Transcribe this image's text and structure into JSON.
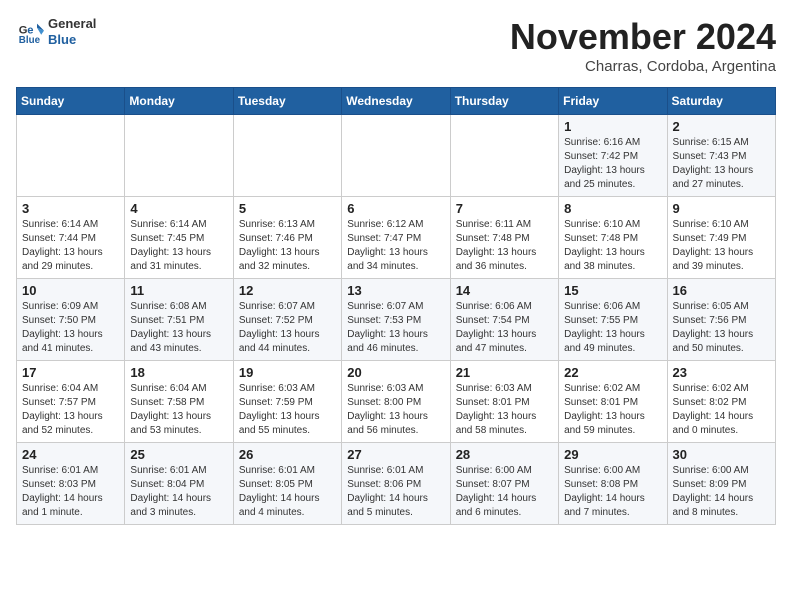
{
  "header": {
    "logo_line1": "General",
    "logo_line2": "Blue",
    "month_title": "November 2024",
    "subtitle": "Charras, Cordoba, Argentina"
  },
  "weekdays": [
    "Sunday",
    "Monday",
    "Tuesday",
    "Wednesday",
    "Thursday",
    "Friday",
    "Saturday"
  ],
  "weeks": [
    [
      {
        "day": "",
        "info": ""
      },
      {
        "day": "",
        "info": ""
      },
      {
        "day": "",
        "info": ""
      },
      {
        "day": "",
        "info": ""
      },
      {
        "day": "",
        "info": ""
      },
      {
        "day": "1",
        "info": "Sunrise: 6:16 AM\nSunset: 7:42 PM\nDaylight: 13 hours\nand 25 minutes."
      },
      {
        "day": "2",
        "info": "Sunrise: 6:15 AM\nSunset: 7:43 PM\nDaylight: 13 hours\nand 27 minutes."
      }
    ],
    [
      {
        "day": "3",
        "info": "Sunrise: 6:14 AM\nSunset: 7:44 PM\nDaylight: 13 hours\nand 29 minutes."
      },
      {
        "day": "4",
        "info": "Sunrise: 6:14 AM\nSunset: 7:45 PM\nDaylight: 13 hours\nand 31 minutes."
      },
      {
        "day": "5",
        "info": "Sunrise: 6:13 AM\nSunset: 7:46 PM\nDaylight: 13 hours\nand 32 minutes."
      },
      {
        "day": "6",
        "info": "Sunrise: 6:12 AM\nSunset: 7:47 PM\nDaylight: 13 hours\nand 34 minutes."
      },
      {
        "day": "7",
        "info": "Sunrise: 6:11 AM\nSunset: 7:48 PM\nDaylight: 13 hours\nand 36 minutes."
      },
      {
        "day": "8",
        "info": "Sunrise: 6:10 AM\nSunset: 7:48 PM\nDaylight: 13 hours\nand 38 minutes."
      },
      {
        "day": "9",
        "info": "Sunrise: 6:10 AM\nSunset: 7:49 PM\nDaylight: 13 hours\nand 39 minutes."
      }
    ],
    [
      {
        "day": "10",
        "info": "Sunrise: 6:09 AM\nSunset: 7:50 PM\nDaylight: 13 hours\nand 41 minutes."
      },
      {
        "day": "11",
        "info": "Sunrise: 6:08 AM\nSunset: 7:51 PM\nDaylight: 13 hours\nand 43 minutes."
      },
      {
        "day": "12",
        "info": "Sunrise: 6:07 AM\nSunset: 7:52 PM\nDaylight: 13 hours\nand 44 minutes."
      },
      {
        "day": "13",
        "info": "Sunrise: 6:07 AM\nSunset: 7:53 PM\nDaylight: 13 hours\nand 46 minutes."
      },
      {
        "day": "14",
        "info": "Sunrise: 6:06 AM\nSunset: 7:54 PM\nDaylight: 13 hours\nand 47 minutes."
      },
      {
        "day": "15",
        "info": "Sunrise: 6:06 AM\nSunset: 7:55 PM\nDaylight: 13 hours\nand 49 minutes."
      },
      {
        "day": "16",
        "info": "Sunrise: 6:05 AM\nSunset: 7:56 PM\nDaylight: 13 hours\nand 50 minutes."
      }
    ],
    [
      {
        "day": "17",
        "info": "Sunrise: 6:04 AM\nSunset: 7:57 PM\nDaylight: 13 hours\nand 52 minutes."
      },
      {
        "day": "18",
        "info": "Sunrise: 6:04 AM\nSunset: 7:58 PM\nDaylight: 13 hours\nand 53 minutes."
      },
      {
        "day": "19",
        "info": "Sunrise: 6:03 AM\nSunset: 7:59 PM\nDaylight: 13 hours\nand 55 minutes."
      },
      {
        "day": "20",
        "info": "Sunrise: 6:03 AM\nSunset: 8:00 PM\nDaylight: 13 hours\nand 56 minutes."
      },
      {
        "day": "21",
        "info": "Sunrise: 6:03 AM\nSunset: 8:01 PM\nDaylight: 13 hours\nand 58 minutes."
      },
      {
        "day": "22",
        "info": "Sunrise: 6:02 AM\nSunset: 8:01 PM\nDaylight: 13 hours\nand 59 minutes."
      },
      {
        "day": "23",
        "info": "Sunrise: 6:02 AM\nSunset: 8:02 PM\nDaylight: 14 hours\nand 0 minutes."
      }
    ],
    [
      {
        "day": "24",
        "info": "Sunrise: 6:01 AM\nSunset: 8:03 PM\nDaylight: 14 hours\nand 1 minute."
      },
      {
        "day": "25",
        "info": "Sunrise: 6:01 AM\nSunset: 8:04 PM\nDaylight: 14 hours\nand 3 minutes."
      },
      {
        "day": "26",
        "info": "Sunrise: 6:01 AM\nSunset: 8:05 PM\nDaylight: 14 hours\nand 4 minutes."
      },
      {
        "day": "27",
        "info": "Sunrise: 6:01 AM\nSunset: 8:06 PM\nDaylight: 14 hours\nand 5 minutes."
      },
      {
        "day": "28",
        "info": "Sunrise: 6:00 AM\nSunset: 8:07 PM\nDaylight: 14 hours\nand 6 minutes."
      },
      {
        "day": "29",
        "info": "Sunrise: 6:00 AM\nSunset: 8:08 PM\nDaylight: 14 hours\nand 7 minutes."
      },
      {
        "day": "30",
        "info": "Sunrise: 6:00 AM\nSunset: 8:09 PM\nDaylight: 14 hours\nand 8 minutes."
      }
    ]
  ]
}
